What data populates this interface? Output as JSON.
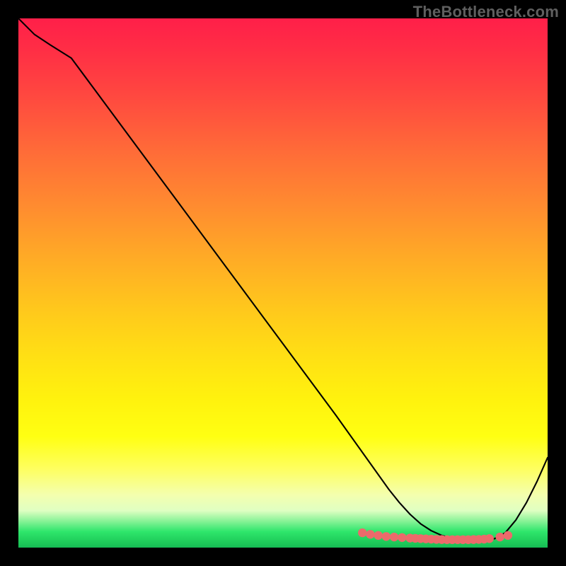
{
  "watermark": "TheBottleneck.com",
  "colors": {
    "frame": "#000000",
    "curve": "#000000",
    "dots": "#ec6a6b",
    "gradient_top": "#ff1f49",
    "gradient_bottom": "#17bb55"
  },
  "chart_data": {
    "type": "line",
    "title": "",
    "xlabel": "",
    "ylabel": "",
    "xlim": [
      0,
      100
    ],
    "ylim": [
      0,
      100
    ],
    "x": [
      0,
      3,
      6,
      10,
      20,
      30,
      40,
      50,
      60,
      65,
      70,
      72,
      74,
      76,
      78,
      80,
      82,
      84,
      86,
      88,
      90,
      92,
      94,
      96,
      98,
      100
    ],
    "values": [
      100,
      97,
      95,
      92.5,
      79,
      65.5,
      52,
      38.5,
      25,
      18,
      11,
      8.5,
      6.3,
      4.5,
      3.2,
      2.3,
      1.7,
      1.4,
      1.3,
      1.4,
      1.7,
      2.8,
      5.2,
      8.5,
      12.5,
      17
    ],
    "dot_points": {
      "x": [
        65,
        66.5,
        68,
        69.5,
        71,
        72.5,
        74,
        75,
        76,
        77,
        78,
        79,
        80,
        81,
        82,
        83,
        84,
        85,
        86,
        87,
        88,
        89,
        91,
        92.5
      ],
      "y": [
        2.8,
        2.5,
        2.3,
        2.1,
        2.0,
        1.9,
        1.8,
        1.75,
        1.7,
        1.65,
        1.6,
        1.55,
        1.52,
        1.5,
        1.5,
        1.5,
        1.5,
        1.5,
        1.52,
        1.55,
        1.6,
        1.7,
        2.0,
        2.3
      ]
    }
  }
}
